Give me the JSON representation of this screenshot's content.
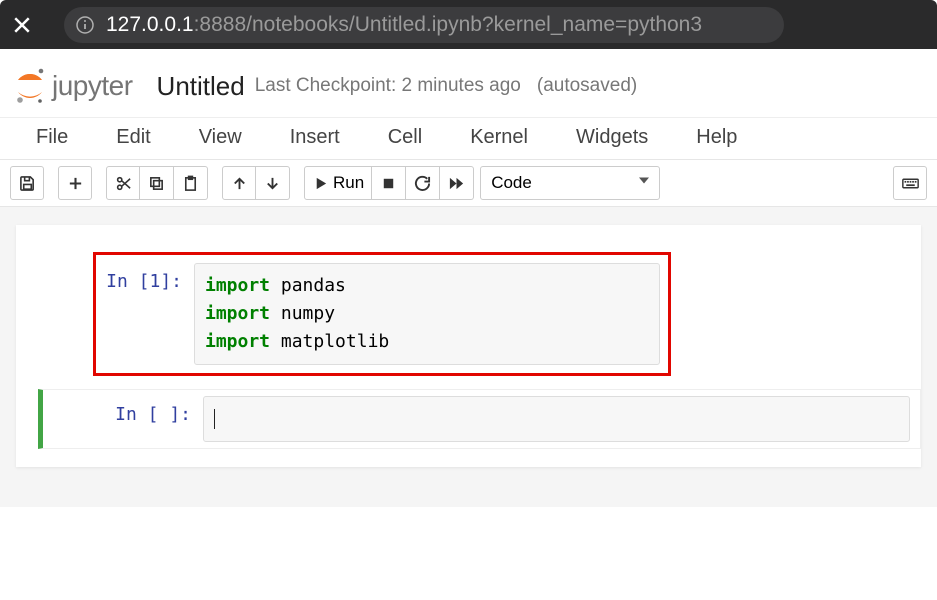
{
  "browser": {
    "url_protocol_host": "127.0.0.1",
    "url_path": ":8888/notebooks/Untitled.ipynb?kernel_name=python3"
  },
  "header": {
    "logo_text": "jupyter",
    "title": "Untitled",
    "checkpoint": "Last Checkpoint: 2 minutes ago",
    "autosaved": "(autosaved)"
  },
  "menu": [
    "File",
    "Edit",
    "View",
    "Insert",
    "Cell",
    "Kernel",
    "Widgets",
    "Help"
  ],
  "toolbar": {
    "run_label": "Run",
    "cell_type_selected": "Code"
  },
  "cells": [
    {
      "prompt": "In [1]:",
      "lines": [
        {
          "keyword": "import",
          "rest": " pandas"
        },
        {
          "keyword": "import",
          "rest": " numpy"
        },
        {
          "keyword": "import",
          "rest": " matplotlib"
        }
      ],
      "highlighted": true
    },
    {
      "prompt": "In [ ]:",
      "lines": [],
      "active": true
    }
  ]
}
